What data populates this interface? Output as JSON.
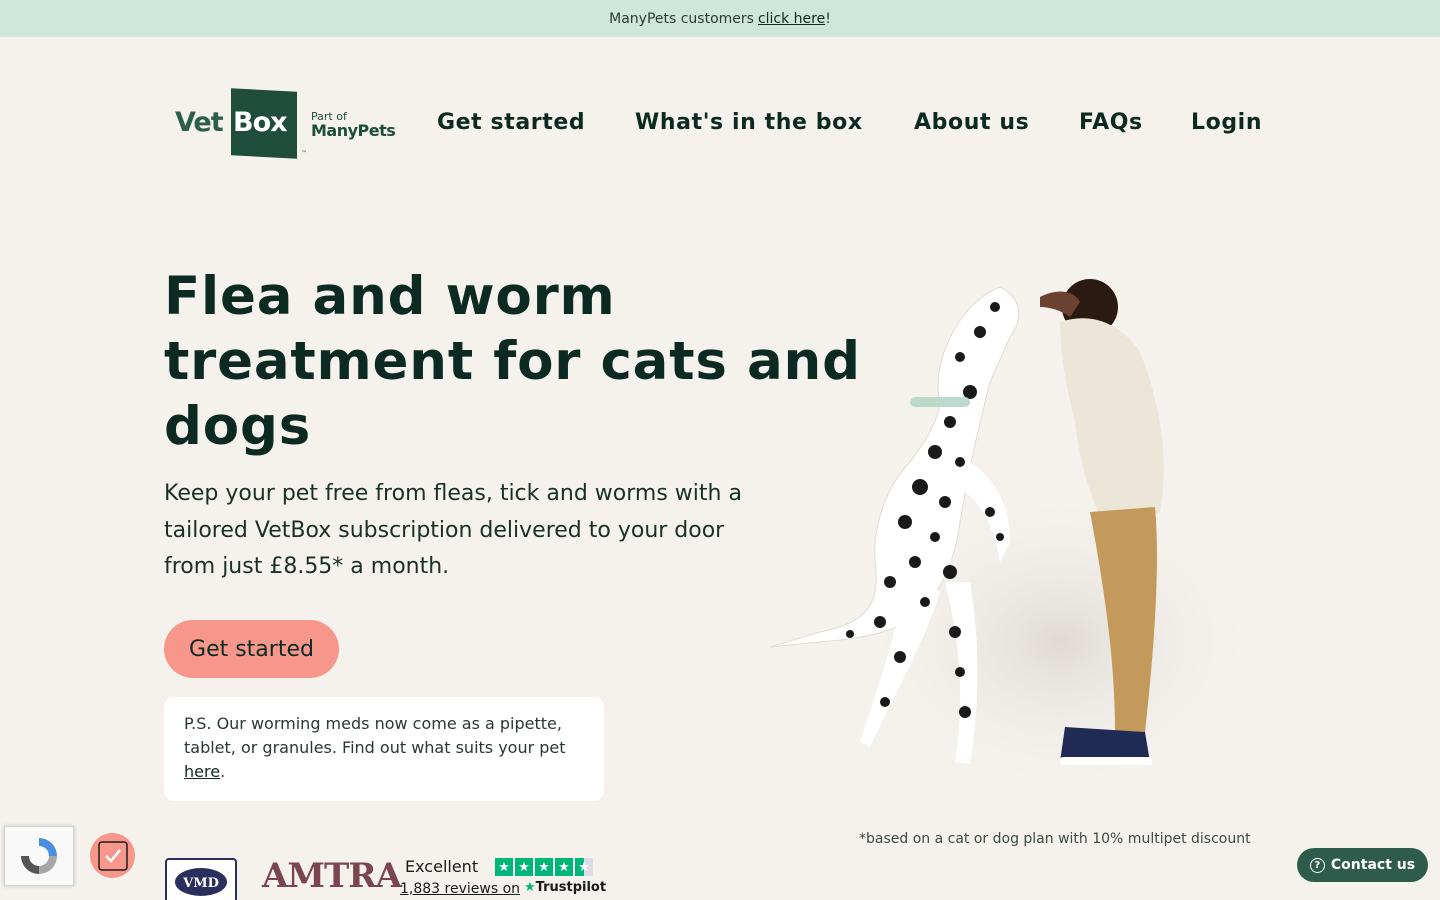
{
  "banner": {
    "text": "ManyPets customers",
    "link": "click here",
    "suffix": "!"
  },
  "logo": {
    "vet": "Vet",
    "box": "Box",
    "tm": "™",
    "part_of": "Part of",
    "manypets": "ManyPets"
  },
  "nav": {
    "items": [
      {
        "label": "Get started"
      },
      {
        "label": "What's in the box"
      },
      {
        "label": "About us"
      },
      {
        "label": "FAQs"
      },
      {
        "label": "Login"
      }
    ]
  },
  "hero": {
    "title": "Flea and worm treatment for cats and dogs",
    "lead": "Keep your pet free from fleas, tick and worms with a tailored VetBox subscription delivered to your door from just £8.55* a month.",
    "cta_label": "Get started",
    "ps_text": "P.S. Our worming meds now come as a pipette, tablet, or granules. Find out what suits your pet",
    "ps_link": "here",
    "ps_suffix": "."
  },
  "disclaimer": "*based on a cat or dog plan with 10% multipet discount",
  "badges": {
    "amtra": "AMTRA",
    "vmd": "VMD"
  },
  "trustpilot": {
    "rating_label": "Excellent",
    "reviews": "1,883 reviews on",
    "logo": "Trustpilot"
  },
  "contact": {
    "label": "Contact us"
  },
  "colors": {
    "accent": "#f7968a",
    "brand_dark": "#0c2a22",
    "banner_bg": "#cfe6dc",
    "page_bg": "#f5f2ee",
    "trustpilot_green": "#00b67a"
  }
}
